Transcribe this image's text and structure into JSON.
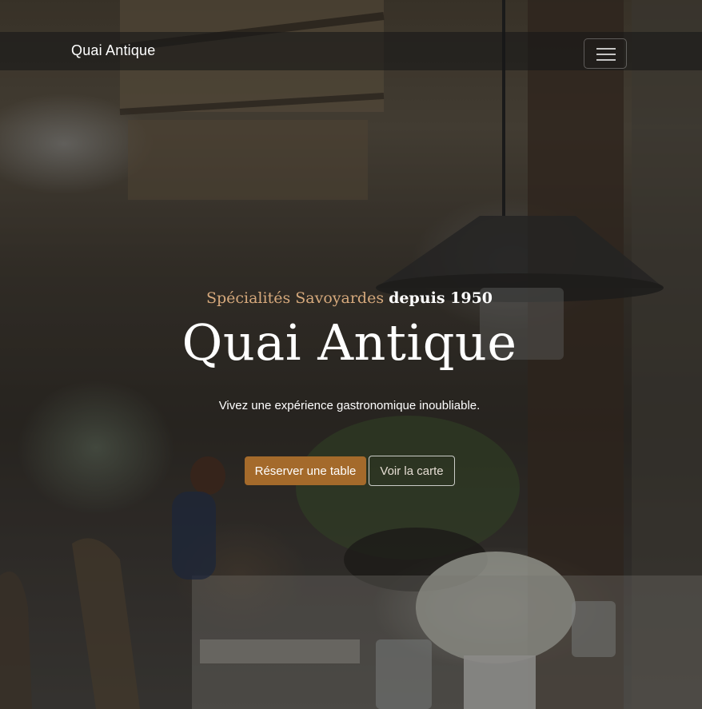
{
  "navbar": {
    "brand": "Quai Antique",
    "toggler_icon": "hamburger-menu-icon"
  },
  "hero": {
    "kicker_accent": "Spécialités Savoyardes",
    "kicker_strong": "depuis 1950",
    "title": "Quai Antique",
    "tagline": "Vivez une expérience gastronomique inoubliable.",
    "primary_button": "Réserver une table",
    "secondary_button": "Voir la carte"
  },
  "colors": {
    "accent": "#a46a2b",
    "kicker_accent": "#d6a97c",
    "navbar_bg": "rgba(25,25,25,0.62)"
  }
}
